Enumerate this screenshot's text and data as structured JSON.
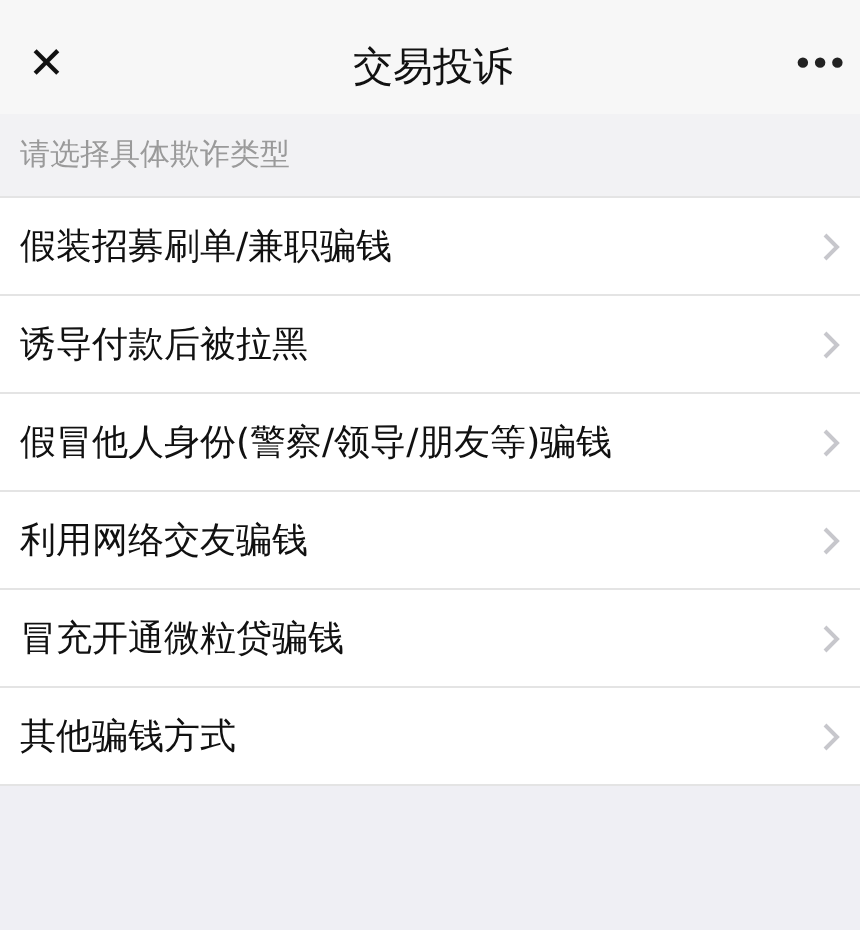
{
  "nav_bar": {
    "close": "✕",
    "title": "交易投诉",
    "more": "•••"
  },
  "section_header": "请选择具体欺诈类型",
  "options": [
    {
      "label": "假装招募刷单/兼职骗钱"
    },
    {
      "label": "诱导付款后被拉黑"
    },
    {
      "label": "假冒他人身份(警察/领导/朋友等)骗钱"
    },
    {
      "label": "利用网络交友骗钱"
    },
    {
      "label": "冒充开通微粒贷骗钱"
    },
    {
      "label": "其他骗钱方式"
    }
  ]
}
